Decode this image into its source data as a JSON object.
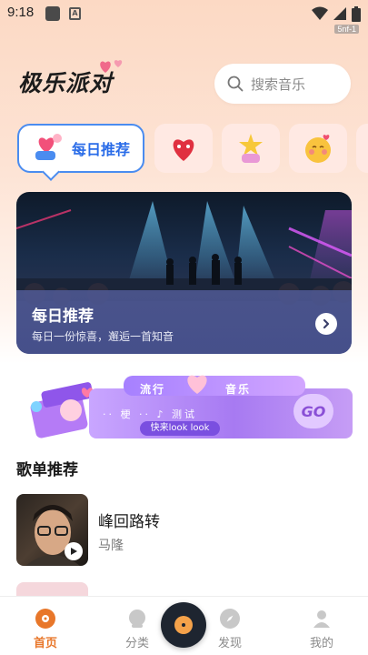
{
  "status_bar": {
    "time": "9:18",
    "build_tag": "5nf-1"
  },
  "header": {
    "logo_text": "极乐派对",
    "search_placeholder": "搜索音乐"
  },
  "categories": [
    {
      "label": "每日推荐",
      "active": true,
      "icon": "heart-mascot-icon"
    },
    {
      "label": "",
      "active": false,
      "icon": "heart-character-icon"
    },
    {
      "label": "",
      "active": false,
      "icon": "star-cake-icon"
    },
    {
      "label": "",
      "active": false,
      "icon": "blush-emoji-icon"
    }
  ],
  "banner": {
    "title": "每日推荐",
    "subtitle": "每日一份惊喜，邂逅一首知音"
  },
  "promo": {
    "word_left": "流行",
    "word_right": "音乐",
    "subtitle": "·· 梗 ·· ♪ 测试",
    "button": "快来look look",
    "go": "GO"
  },
  "playlist_section": {
    "title": "歌单推荐",
    "items": [
      {
        "name": "峰回路转",
        "artist": "马隆"
      }
    ]
  },
  "bottom_nav": [
    {
      "label": "首页",
      "active": true,
      "icon": "home-vinyl-icon"
    },
    {
      "label": "分类",
      "active": false,
      "icon": "category-icon"
    },
    {
      "label": "发现",
      "active": false,
      "icon": "compass-icon"
    },
    {
      "label": "我的",
      "active": false,
      "icon": "user-icon"
    }
  ],
  "colors": {
    "accent": "#e8772a",
    "active_blue": "#2a6ce8",
    "promo_purple": "#a77af2"
  }
}
